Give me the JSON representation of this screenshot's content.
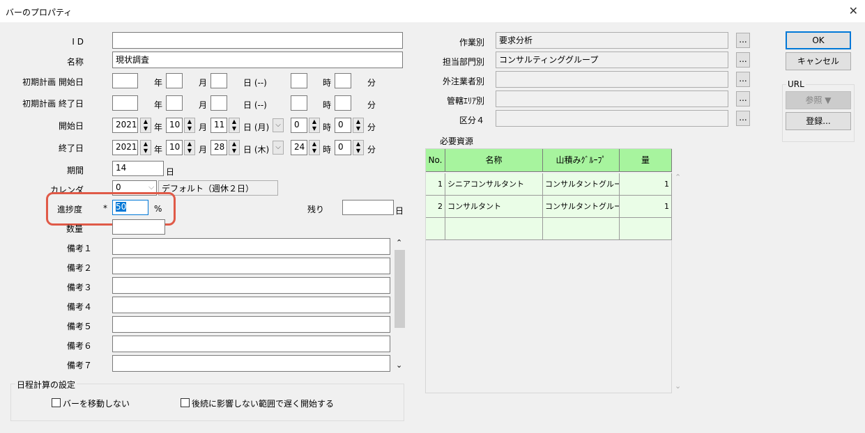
{
  "window": {
    "title": "バーのプロパティ",
    "close_glyph": "✕"
  },
  "fields": {
    "id": {
      "label": "I D",
      "value": ""
    },
    "name": {
      "label": "名称",
      "value": "現状調査"
    },
    "plan_start": {
      "label": "初期計画 開始日",
      "year_u": "年",
      "month_u": "月",
      "day_u": "日 (--)",
      "hour_u": "時",
      "min_u": "分"
    },
    "plan_end": {
      "label": "初期計画 終了日",
      "year_u": "年",
      "month_u": "月",
      "day_u": "日 (--)",
      "hour_u": "時",
      "min_u": "分"
    },
    "start": {
      "label": "開始日",
      "year": "2021",
      "year_u": "年",
      "month": "10",
      "month_u": "月",
      "day": "11",
      "day_u": "日 (月)",
      "hour": "0",
      "hour_u": "時",
      "min": "0",
      "min_u": "分"
    },
    "end": {
      "label": "終了日",
      "year": "2021",
      "year_u": "年",
      "month": "10",
      "month_u": "月",
      "day": "28",
      "day_u": "日 (木)",
      "hour": "24",
      "hour_u": "時",
      "min": "0",
      "min_u": "分"
    },
    "period": {
      "label": "期間",
      "value": "14",
      "unit": "日"
    },
    "calendar": {
      "label": "カレンダ",
      "value": "0",
      "name": "デフォルト（週休２日）"
    },
    "progress": {
      "label": "進捗度",
      "asterisk": "*",
      "value": "50",
      "unit": "%"
    },
    "remaining": {
      "label": "残り",
      "value": "",
      "unit": "日"
    },
    "quantity": {
      "label": "数量",
      "value": ""
    },
    "notes": [
      {
        "label": "備考１",
        "value": ""
      },
      {
        "label": "備考２",
        "value": ""
      },
      {
        "label": "備考３",
        "value": ""
      },
      {
        "label": "備考４",
        "value": ""
      },
      {
        "label": "備考５",
        "value": ""
      },
      {
        "label": "備考６",
        "value": ""
      },
      {
        "label": "備考７",
        "value": ""
      }
    ]
  },
  "categories": [
    {
      "label": "作業別",
      "value": "要求分析"
    },
    {
      "label": "担当部門別",
      "value": "コンサルティンググループ"
    },
    {
      "label": "外注業者別",
      "value": ""
    },
    {
      "label": "管轄ｴﾘｱ別",
      "value": ""
    },
    {
      "label": "区分４",
      "value": ""
    }
  ],
  "ellipsis": "...",
  "resources": {
    "title": "必要資源",
    "headers": [
      "No.",
      "名称",
      "山積みｸﾞﾙｰﾌﾟ",
      "量"
    ],
    "rows": [
      {
        "no": "1",
        "name": "シニアコンサルタント",
        "group": "コンサルタントグループ",
        "qty": "1"
      },
      {
        "no": "2",
        "name": "コンサルタント",
        "group": "コンサルタントグループ",
        "qty": "1"
      }
    ]
  },
  "buttons": {
    "ok": "OK",
    "cancel": "キャンセル",
    "url_label": "URL",
    "browse": "参照 ▼",
    "register": "登録..."
  },
  "schedule": {
    "title": "日程計算の設定",
    "no_move": "バーを移動しない",
    "late_start": "後続に影響しない範囲で遅く開始する"
  },
  "colors": {
    "grid_header": "#a7f49e",
    "grid_row": "#eafde7",
    "highlight": "#e05a48",
    "default_button": "#0078d7"
  }
}
